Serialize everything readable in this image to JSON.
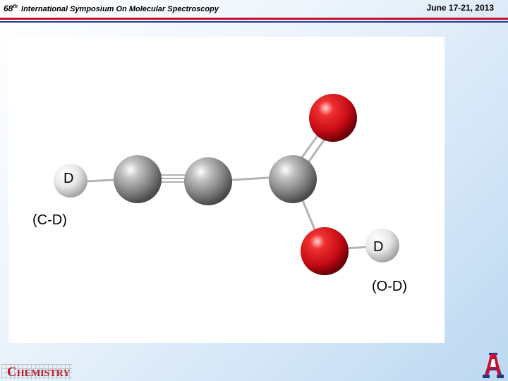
{
  "header": {
    "edition_number": "68",
    "edition_suffix": "th",
    "title_rest": "International Symposium On Molecular Spectroscopy",
    "date": "June 17-21, 2013"
  },
  "molecule": {
    "labels": {
      "cd_atom": "D",
      "cd_bond": "(C-D)",
      "od_atom": "D",
      "od_bond": "(O-D)"
    },
    "colors": {
      "carbon": "#8c8c8c",
      "oxygen": "#e0141e",
      "deuterium": "#e6e6e6",
      "bond": "#b4b4b4"
    }
  },
  "footer": {
    "chemistry_logo_first": "C",
    "chemistry_logo_rest": "HEMISTRY",
    "university_logo_letter": "A"
  }
}
